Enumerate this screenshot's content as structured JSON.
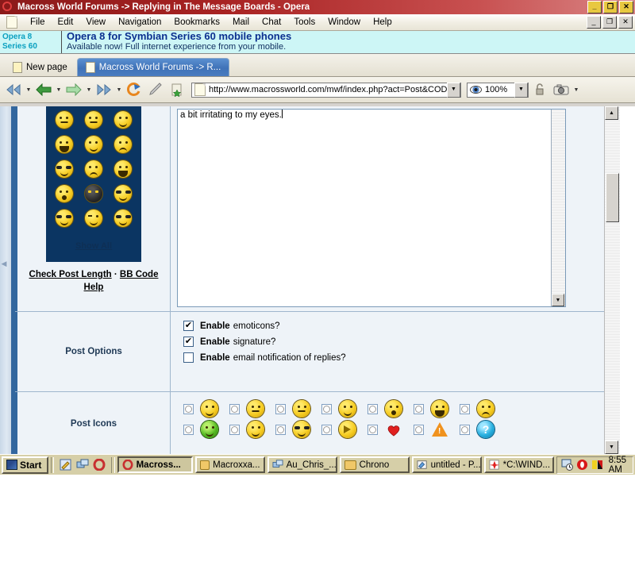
{
  "window": {
    "title": "Macross World Forums -> Replying in The Message Boards - Opera",
    "app_icon": "opera-logo-icon",
    "controls": {
      "minimize": "_",
      "maximize": "❐",
      "close": "✕"
    }
  },
  "menu": {
    "items": [
      {
        "label": "File",
        "accel": "F"
      },
      {
        "label": "Edit",
        "accel": "E"
      },
      {
        "label": "View",
        "accel": "V"
      },
      {
        "label": "Navigation",
        "accel": "N"
      },
      {
        "label": "Bookmarks",
        "accel": "B"
      },
      {
        "label": "Mail",
        "accel": "M"
      },
      {
        "label": "Chat",
        "accel": "C"
      },
      {
        "label": "Tools",
        "accel": "T"
      },
      {
        "label": "Window",
        "accel": "W"
      },
      {
        "label": "Help",
        "accel": "H"
      }
    ],
    "mdi_controls": {
      "minimize": "_",
      "restore": "❐",
      "close": "✕"
    }
  },
  "ad": {
    "badge_line1": "Opera 8",
    "badge_line2": "Series 60",
    "headline": "Opera 8 for Symbian Series 60 mobile phones",
    "subline": "Available now! Full internet experience from your mobile."
  },
  "tabs": [
    {
      "label": "New page",
      "active": false
    },
    {
      "label": "Macross World Forums -> R...",
      "active": true
    }
  ],
  "toolbar": {
    "buttons": [
      {
        "name": "rewind-button",
        "glyph": "◀◀"
      },
      {
        "name": "back-button",
        "glyph": "←"
      },
      {
        "name": "forward-button",
        "glyph": "→"
      },
      {
        "name": "fast-forward-button",
        "glyph": "▶▶"
      },
      {
        "name": "reload-button",
        "glyph": "↻"
      },
      {
        "name": "edit-button",
        "glyph": "✐"
      },
      {
        "name": "bookmark-button",
        "glyph": "★"
      }
    ],
    "url": "http://www.macrossworld.com/mwf/index.php?act=Post&CODE=",
    "zoom": "100%",
    "dropdown_glyph": "▼"
  },
  "page": {
    "textarea": {
      "visible_text": "a bit irritating to my eyes."
    },
    "emoticon_panel": {
      "show_all_label": "Show All",
      "rows": [
        [
          "smirk",
          "neutral",
          "smile"
        ],
        [
          "laugh",
          "tongue",
          "angry"
        ],
        [
          "rolleyes",
          "sad",
          "grin"
        ],
        [
          "surprised",
          "ninja",
          "happy-eyes"
        ],
        [
          "crazy",
          "wink",
          "cool"
        ]
      ]
    },
    "links": {
      "check_post_length": "Check Post Length",
      "separator": "·",
      "bb_code_help": "BB Code Help"
    },
    "post_options": {
      "section_label": "Post Options",
      "options": [
        {
          "strong": "Enable",
          "rest": "emoticons?",
          "checked": true
        },
        {
          "strong": "Enable",
          "rest": "signature?",
          "checked": true
        },
        {
          "strong": "Enable",
          "rest": "email notification of replies?",
          "checked": false
        }
      ]
    },
    "post_icons": {
      "section_label": "Post Icons",
      "rows": [
        [
          "smile",
          "rolleyes",
          "sleepy",
          "smirk",
          "surprised",
          "grin",
          "angry"
        ],
        [
          "sick-green",
          "puppy-eyes",
          "cool-shades",
          "arrow",
          "heart",
          "warning",
          "question"
        ]
      ]
    }
  },
  "scrollbar": {
    "up_arrow": "▲",
    "down_arrow": "▼"
  },
  "taskbar": {
    "start_label": "Start",
    "quick_launch": [
      "notepad-icon",
      "network-icon",
      "opera-icon"
    ],
    "buttons": [
      {
        "label": "Macross...",
        "icon": "opera-icon",
        "active": true
      },
      {
        "label": "Macroxxa...",
        "icon": "folder-icon",
        "active": false
      },
      {
        "label": "Au_Chris_...",
        "icon": "network-icon",
        "active": false
      },
      {
        "label": "Chrono",
        "icon": "folder-icon",
        "active": false
      },
      {
        "label": "untitled - P...",
        "icon": "paint-icon",
        "active": false
      },
      {
        "label": "*C:\\WIND...",
        "icon": "editor-icon",
        "active": false
      }
    ],
    "tray_icons": [
      "scheduler-icon",
      "opera-tray-icon",
      "display-icon"
    ],
    "clock": "8:55 AM"
  },
  "colors": {
    "title_bar": "#8b1a1a",
    "ad_background": "#cdf6f6",
    "ad_headline": "#0b2f8f",
    "tab_active": "#3f72b8",
    "forum_bg": "#eef3f8",
    "forum_border": "#9fb6cd",
    "emoticon_panel_bg": "#0b3562",
    "side_column": "#33679e",
    "taskbar": "#d6cfa8"
  }
}
